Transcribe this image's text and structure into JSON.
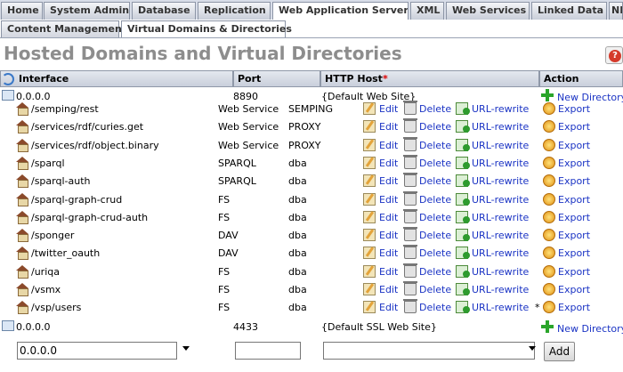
{
  "tabs": [
    "Home",
    "System Admin",
    "Database",
    "Replication",
    "Web Application Server",
    "XML",
    "Web Services",
    "Linked Data",
    "NNTP"
  ],
  "subtabs": [
    "Content Management",
    "Virtual Domains & Directories"
  ],
  "page_title": "Hosted Domains and Virtual Directories",
  "help_label": "?",
  "table": {
    "headers": {
      "interface": "Interface",
      "port": "Port",
      "http_host": "HTTP Host",
      "required_mark": "*",
      "action": "Action"
    },
    "hosts": [
      {
        "interface": "0.0.0.0",
        "port": "8890",
        "http_host": "{Default Web Site}",
        "new_dir": "New Directory"
      },
      {
        "interface": "0.0.0.0",
        "port": "4433",
        "http_host": "{Default SSL Web Site}",
        "new_dir": "New Directory"
      }
    ],
    "dirs": [
      {
        "path": "/semping/rest",
        "type": "Web Service",
        "user": "SEMPING",
        "star": ""
      },
      {
        "path": "/services/rdf/curies.get",
        "type": "Web Service",
        "user": "PROXY",
        "star": ""
      },
      {
        "path": "/services/rdf/object.binary",
        "type": "Web Service",
        "user": "PROXY",
        "star": ""
      },
      {
        "path": "/sparql",
        "type": "SPARQL",
        "user": "dba",
        "star": ""
      },
      {
        "path": "/sparql-auth",
        "type": "SPARQL",
        "user": "dba",
        "star": ""
      },
      {
        "path": "/sparql-graph-crud",
        "type": "FS",
        "user": "dba",
        "star": ""
      },
      {
        "path": "/sparql-graph-crud-auth",
        "type": "FS",
        "user": "dba",
        "star": ""
      },
      {
        "path": "/sponger",
        "type": "DAV",
        "user": "dba",
        "star": ""
      },
      {
        "path": "/twitter_oauth",
        "type": "DAV",
        "user": "dba",
        "star": ""
      },
      {
        "path": "/uriqa",
        "type": "FS",
        "user": "dba",
        "star": ""
      },
      {
        "path": "/vsmx",
        "type": "FS",
        "user": "dba",
        "star": ""
      },
      {
        "path": "/vsp/users",
        "type": "FS",
        "user": "dba",
        "star": "*"
      }
    ],
    "actions": {
      "edit": "Edit",
      "delete": "Delete",
      "url_rewrite": "URL-rewrite",
      "export": "Export"
    }
  },
  "form": {
    "interface_value": "0.0.0.0",
    "port_value": "",
    "host_value": "",
    "add_label": "Add"
  },
  "icons": [
    "refresh-icon",
    "server-icon",
    "house-icon",
    "edit-icon",
    "trash-icon",
    "url-rewrite-icon",
    "export-icon",
    "plus-icon",
    "help-icon",
    "chevron-down-icon"
  ],
  "colors": {
    "link": "#1a33c4",
    "title": "#8d8d8d",
    "tab_bg": "#d8dde8",
    "header_bg": "#c9cfdb",
    "required": "#dd0000"
  }
}
